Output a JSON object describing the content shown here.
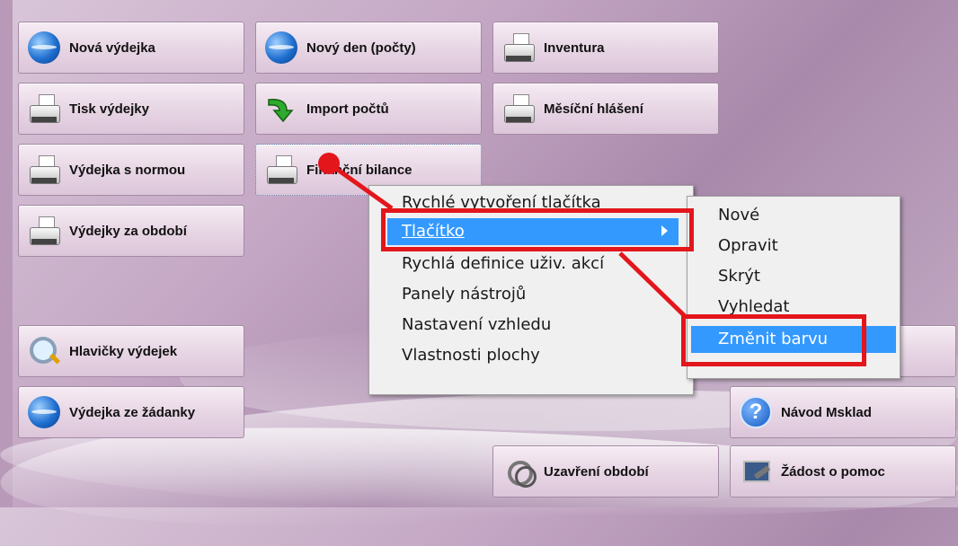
{
  "tiles": {
    "nova_vydejka": "Nová výdejka",
    "tisk_vydejky": "Tisk výdejky",
    "vydejka_s_normou": "Výdejka s normou",
    "vydejky_za_obdobi": "Výdejky za období",
    "novy_den": "Nový den (počty)",
    "import_poctu": "Import počtů",
    "financni_bilance": "Finanční bilance",
    "inventura": "Inventura",
    "mesicni_hlaseni": "Měsíční hlášení",
    "hlavicky_vydejek": "Hlavičky výdejek",
    "vydejka_ze_zadanky": "Výdejka ze žádanky",
    "navod_msklad": "Návod Msklad",
    "uzavreni_obdobi": "Uzavření období",
    "zadost_o_pomoc": "Žádost o pomoc"
  },
  "context_menu": {
    "items": [
      "Rychlé vytvoření tlačítka",
      "Tlačítko",
      "Rychlá definice uživ. akcí",
      "Panely nástrojů",
      "Nastavení vzhledu",
      "Vlastnosti plochy"
    ]
  },
  "submenu": {
    "items": [
      "Nové",
      "Opravit",
      "Skrýt",
      "Vyhledat",
      "Změnit barvu"
    ]
  },
  "colors": {
    "menu_highlight": "#3399ff",
    "annotation": "#e3161c"
  }
}
